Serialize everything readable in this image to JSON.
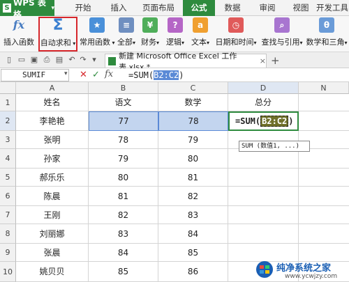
{
  "menubar": {
    "app_label": "WPS 表格",
    "tabs": [
      {
        "label": "开始"
      },
      {
        "label": "插入"
      },
      {
        "label": "页面布局"
      },
      {
        "label": "公式"
      },
      {
        "label": "数据"
      },
      {
        "label": "审阅"
      },
      {
        "label": "视图"
      },
      {
        "label": "开发工具"
      }
    ],
    "active_tab": "公式",
    "accent_color": "#2e8b3e"
  },
  "ribbon": {
    "buttons": [
      {
        "label": "插入函数",
        "icon": "fx-icon"
      },
      {
        "label": "自动求和",
        "icon": "sigma-icon",
        "highlighted": true
      },
      {
        "label": "常用函数",
        "icon": "star-icon"
      },
      {
        "label": "全部",
        "icon": "list-icon"
      },
      {
        "label": "财务",
        "icon": "finance-icon"
      },
      {
        "label": "逻辑",
        "icon": "logic-icon"
      },
      {
        "label": "文本",
        "icon": "text-icon"
      },
      {
        "label": "日期和时间",
        "icon": "clock-icon"
      },
      {
        "label": "查找与引用",
        "icon": "search-icon"
      },
      {
        "label": "数学和三角",
        "icon": "math-icon"
      }
    ],
    "highlight_color": "#d6262b"
  },
  "doc_tab": {
    "label": "新建 Microsoft Office Excel 工作表.xlsx *"
  },
  "formula_bar": {
    "name_box": "SUMIF",
    "formula_prefix": "=SUM(",
    "formula_ref": "B2:C2",
    "formula_suffix": ")"
  },
  "sheet": {
    "columns": [
      "A",
      "B",
      "C",
      "D",
      "N"
    ],
    "rows": [
      "1",
      "2",
      "3",
      "4",
      "5",
      "6",
      "7",
      "8",
      "9",
      "10"
    ],
    "headers": [
      "姓名",
      "语文",
      "数学",
      "总分"
    ],
    "data": [
      {
        "name": "李艳艳",
        "chinese": "77",
        "math": "78"
      },
      {
        "name": "张明",
        "chinese": "78",
        "math": "79"
      },
      {
        "name": "孙家",
        "chinese": "79",
        "math": "80"
      },
      {
        "name": "郝乐乐",
        "chinese": "80",
        "math": "81"
      },
      {
        "name": "陈晨",
        "chinese": "81",
        "math": "82"
      },
      {
        "name": "王刚",
        "chinese": "82",
        "math": "83"
      },
      {
        "name": "刘丽娜",
        "chinese": "83",
        "math": "84"
      },
      {
        "name": "张晨",
        "chinese": "84",
        "math": "85"
      },
      {
        "name": "姚贝贝",
        "chinese": "85",
        "math": "86"
      }
    ],
    "edit_cell": {
      "prefix": "=SUM(",
      "ref": "B2:C2",
      "suffix": ")"
    },
    "tooltip": "SUM (数值1, ...)"
  },
  "watermark": {
    "title": "纯净系统之家",
    "url": "www.ycwjzy.com"
  }
}
